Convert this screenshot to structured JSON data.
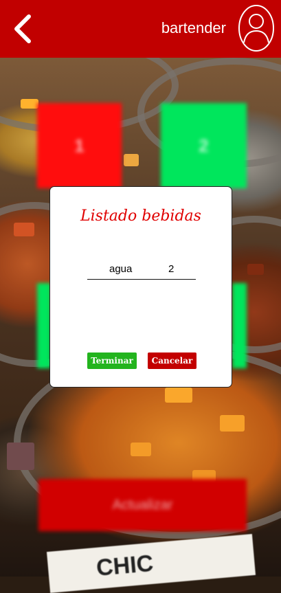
{
  "header": {
    "back_icon": "chevron-left-icon",
    "user_name": "bartender",
    "avatar_icon": "user-avatar-icon",
    "background_color": "#c10000"
  },
  "tiles": [
    {
      "label": "1",
      "color": "#ff0d0d"
    },
    {
      "label": "2",
      "color": "#00e65c"
    }
  ],
  "update_button": {
    "label": "Actualizar",
    "color": "#d10000"
  },
  "sign_text": "CHIC",
  "modal": {
    "title": "Listado bebidas",
    "drinks": [
      {
        "name": "agua",
        "quantity": "2"
      }
    ],
    "confirm_label": "Terminar",
    "cancel_label": "Cancelar",
    "confirm_color": "#23b41e",
    "cancel_color": "#c30000"
  }
}
